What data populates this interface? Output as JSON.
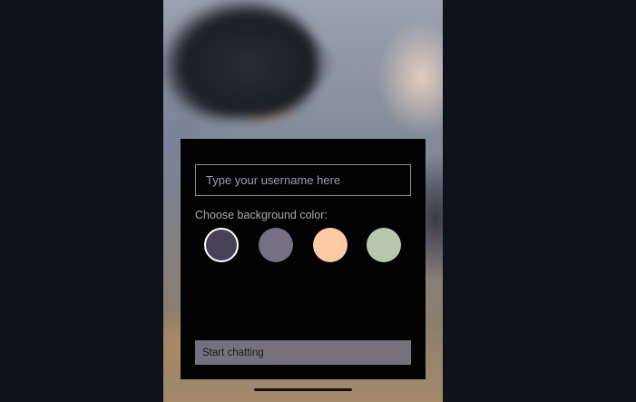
{
  "start_screen": {
    "username_placeholder": "Type your username here",
    "username_value": "",
    "color_label": "Choose background color:",
    "colors": [
      {
        "name": "dark-purple",
        "hex": "#474157",
        "selected": true
      },
      {
        "name": "gray-purple",
        "hex": "#757083",
        "selected": false
      },
      {
        "name": "peach",
        "hex": "#FFCBA4",
        "selected": false
      },
      {
        "name": "sage-green",
        "hex": "#B9C6AE",
        "selected": false
      }
    ],
    "start_button_label": "Start chatting"
  }
}
